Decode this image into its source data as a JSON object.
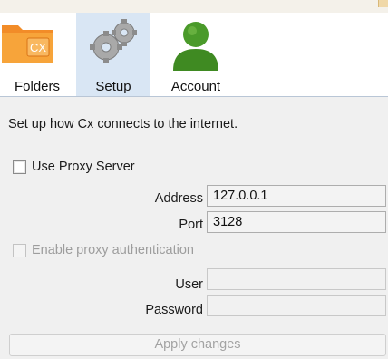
{
  "toolbar": {
    "tabs": [
      {
        "label": "Folders",
        "icon": "folder-icon",
        "badge": "CX"
      },
      {
        "label": "Setup",
        "icon": "gears-icon",
        "active": true
      },
      {
        "label": "Account",
        "icon": "user-icon"
      }
    ]
  },
  "setup": {
    "intro": "Set up how Cx connects to the internet.",
    "use_proxy_label": "Use Proxy Server",
    "use_proxy_checked": false,
    "address_label": "Address",
    "address_value": "127.0.0.1",
    "port_label": "Port",
    "port_value": "3128",
    "auth_label": "Enable proxy authentication",
    "auth_checked": false,
    "user_label": "User",
    "user_value": "",
    "password_label": "Password",
    "password_value": "",
    "apply_label": "Apply changes"
  },
  "colors": {
    "active_tab_bg": "#d9e6f4",
    "folder_orange": "#f28c28",
    "user_green": "#4a9a2a"
  }
}
